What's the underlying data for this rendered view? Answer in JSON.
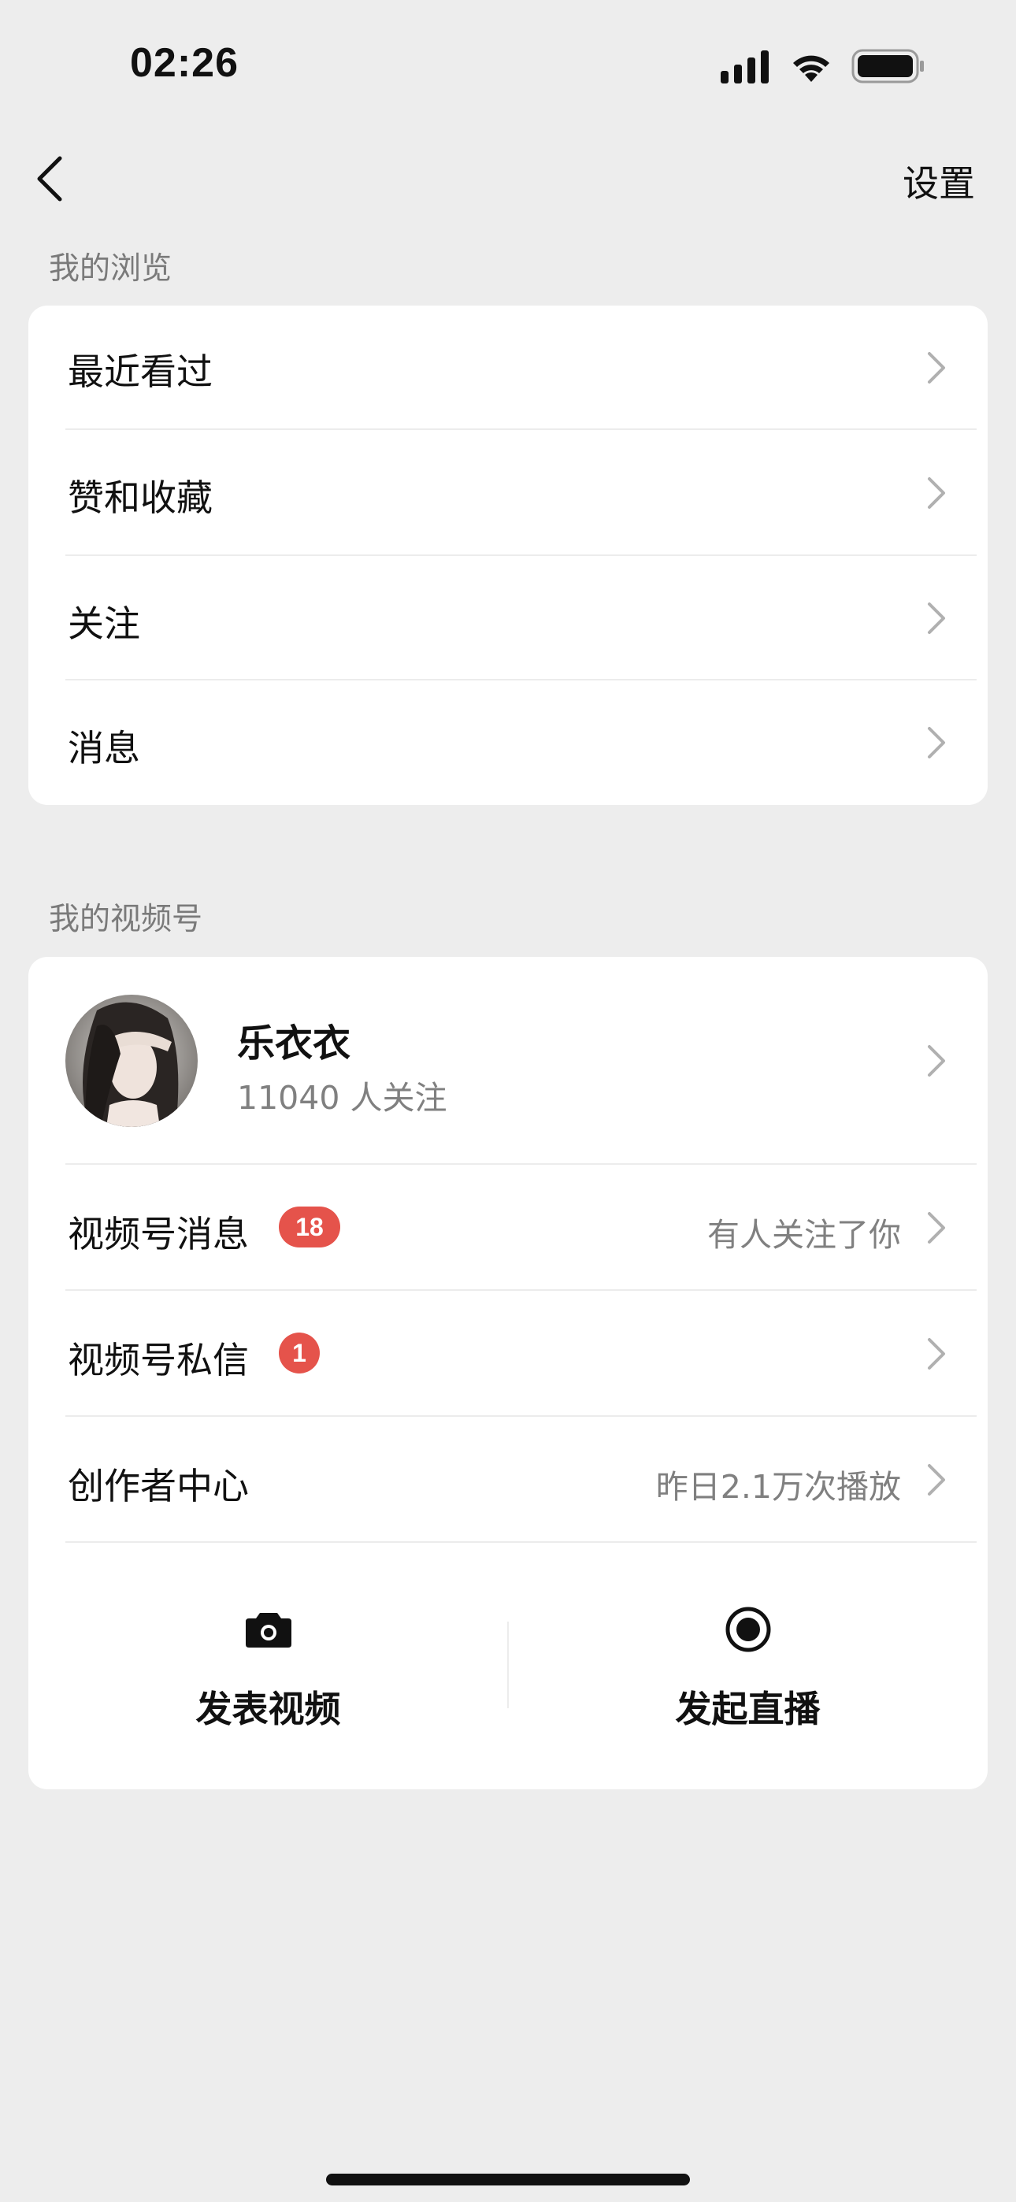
{
  "status_bar": {
    "time": "02:26"
  },
  "nav": {
    "back_icon": "chevron-left-icon",
    "settings_label": "设置"
  },
  "browse_section": {
    "title": "我的浏览",
    "items": [
      {
        "label": "最近看过"
      },
      {
        "label": "赞和收藏"
      },
      {
        "label": "关注"
      },
      {
        "label": "消息"
      }
    ]
  },
  "channels_section": {
    "title": "我的视频号",
    "profile": {
      "name": "乐衣衣",
      "followers": "11040 人关注"
    },
    "rows": [
      {
        "label": "视频号消息",
        "badge": "18",
        "right_text": "有人关注了你"
      },
      {
        "label": "视频号私信",
        "badge": "1",
        "right_text": ""
      },
      {
        "label": "创作者中心",
        "badge": "",
        "right_text": "昨日2.1万次播放"
      }
    ],
    "actions": [
      {
        "label": "发表视频",
        "icon": "camera-icon"
      },
      {
        "label": "发起直播",
        "icon": "live-record-icon"
      }
    ]
  },
  "colors": {
    "background": "#ededed",
    "card": "#ffffff",
    "badge": "#e5534b",
    "secondary_text": "#808080"
  }
}
